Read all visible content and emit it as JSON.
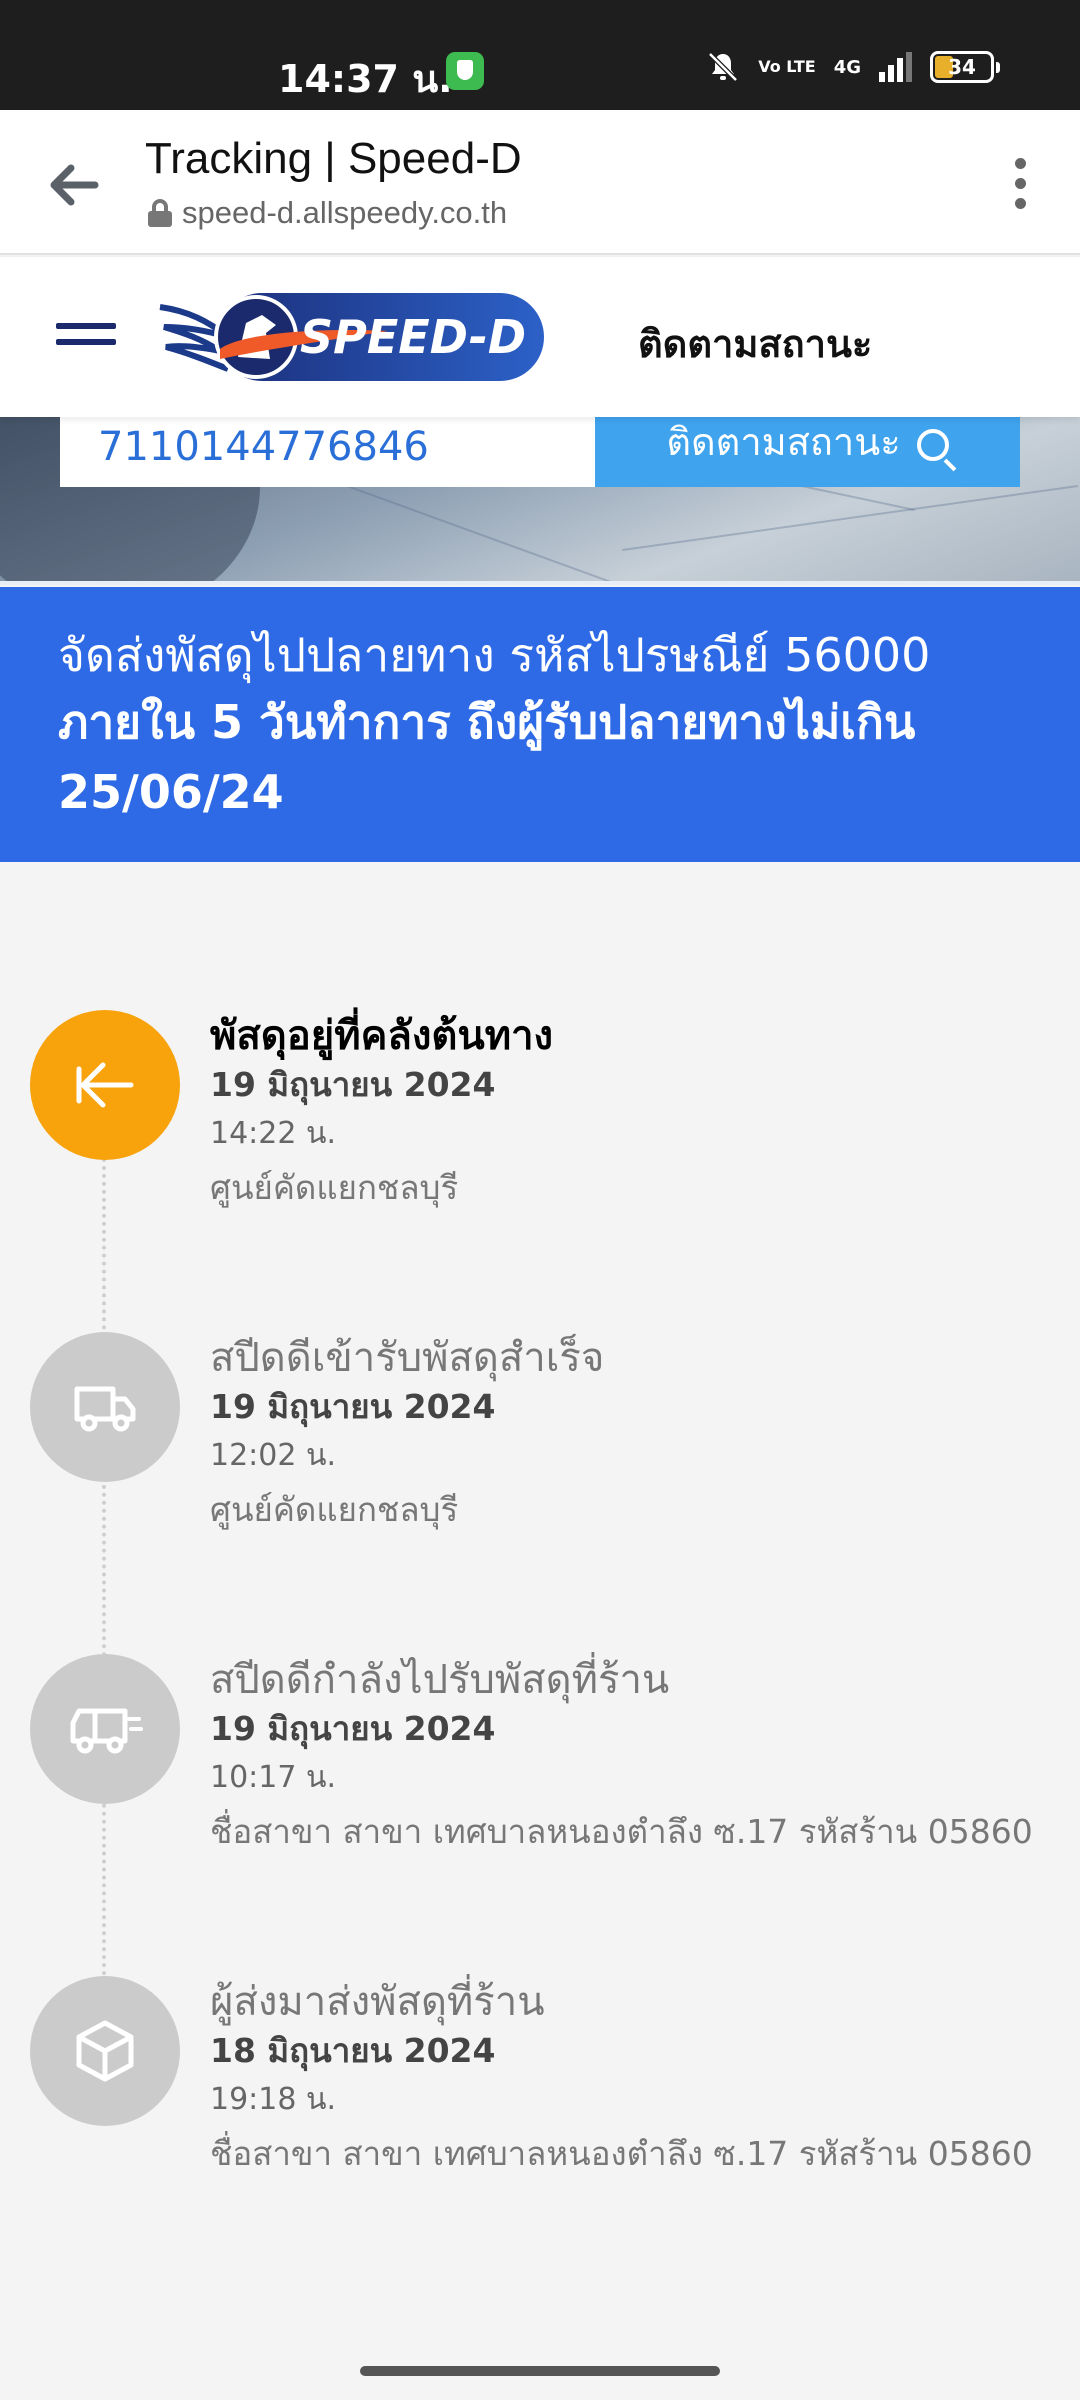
{
  "status_bar": {
    "time": "14:37 น.",
    "network": "4G",
    "volte": "Vo LTE",
    "battery": "34"
  },
  "browser": {
    "page_title": "Tracking | Speed-D",
    "url": "speed-d.allspeedy.co.th"
  },
  "header": {
    "logo_text": "SPEED-D",
    "nav_label": "ติดตามสถานะ"
  },
  "search": {
    "tracking_number": "7110144776846",
    "button_label": "ติดตามสถานะ"
  },
  "banner": {
    "line1": "จัดส่งพัสดุไปปลายทาง รหัสไปรษณีย์ 56000",
    "line2": "ภายใน 5 วันทำการ ถึงผู้รับปลายทางไม่เกิน",
    "line3": "25/06/24"
  },
  "timeline": [
    {
      "icon": "warehouse-arrow-icon",
      "title": "พัสดุอยู่ที่คลังต้นทาง",
      "date": "19 มิถุนายน 2024",
      "time": "14:22 น.",
      "place": "ศูนย์คัดแยกชลบุรี",
      "active": true
    },
    {
      "icon": "truck-icon",
      "title": "สปีดดีเข้ารับพัสดุสำเร็จ",
      "date": "19 มิถุนายน 2024",
      "time": "12:02 น.",
      "place": "ศูนย์คัดแยกชลบุรี",
      "active": false
    },
    {
      "icon": "moving-truck-icon",
      "title": "สปีดดีกำลังไปรับพัสดุที่ร้าน",
      "date": "19 มิถุนายน 2024",
      "time": "10:17 น.",
      "place": "ชื่อสาขา สาขา เทศบาลหนองตำลึง ซ.17 รหัสร้าน 05860",
      "active": false
    },
    {
      "icon": "package-icon",
      "title": "ผู้ส่งมาส่งพัสดุที่ร้าน",
      "date": "18 มิถุนายน 2024",
      "time": "19:18 น.",
      "place": "ชื่อสาขา สาขา เทศบาลหนองตำลึง ซ.17 รหัสร้าน 05860",
      "active": false
    }
  ],
  "colors": {
    "banner": "#2e6ae6",
    "active_step": "#f8a20c",
    "inactive_step": "#cbcbcb",
    "search_button": "#3fa3ee"
  }
}
